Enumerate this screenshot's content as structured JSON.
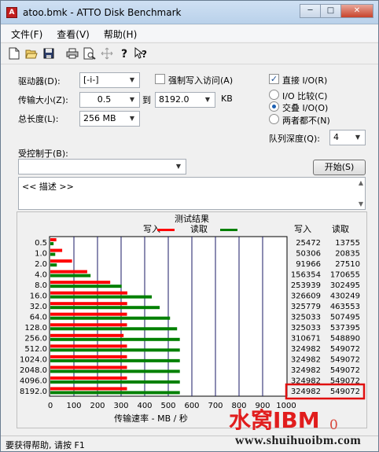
{
  "window": {
    "title": "atoo.bmk - ATTO Disk Benchmark",
    "app_icon": "A"
  },
  "title_buttons": {
    "minimize": "─",
    "maximize": "□",
    "close": "✕"
  },
  "menu": [
    "文件(F)",
    "查看(V)",
    "帮助(H)"
  ],
  "toolbar_icons": [
    "new-file-icon",
    "open-folder-icon",
    "save-icon",
    "print-icon",
    "print-preview-icon",
    "move-icon",
    "help-icon",
    "context-help-icon"
  ],
  "settings": {
    "drive_label": "驱动器(D):",
    "drive_value": "[-i-]",
    "force_write_label": "强制写入访问(A)",
    "force_write_checked": false,
    "transfer_label": "传输大小(Z):",
    "transfer_from": "0.5",
    "transfer_to_label": "到",
    "transfer_to": "8192.0",
    "transfer_unit": "KB",
    "total_label": "总长度(L):",
    "total_value": "256 MB",
    "direct_io_label": "直接 I/O(R)",
    "direct_io_checked": true,
    "io_compare_label": "I/O 比较(C)",
    "overlap_io_label": "交叠 I/O(O)",
    "neither_label": "两者都不(N)",
    "selected_io_mode": "overlap",
    "queue_label": "队列深度(Q):",
    "queue_value": "4",
    "controlled_by_label": "受控制于(B):",
    "controlled_by_value": "",
    "start_button": "开始(S)",
    "description": "<< 描述 >>"
  },
  "results": {
    "title": "测试结果",
    "legend_write": "写入",
    "legend_read": "读取",
    "col_write": "写入",
    "col_read": "读取",
    "xlabel": "传输速率 - MB / 秒"
  },
  "chart_data": {
    "type": "bar",
    "title": "测试结果",
    "xlabel": "传输速率 - MB / 秒",
    "ylabel": "",
    "categories": [
      "0.5",
      "1.0",
      "2.0",
      "4.0",
      "8.0",
      "16.0",
      "32.0",
      "64.0",
      "128.0",
      "256.0",
      "512.0",
      "1024.0",
      "2048.0",
      "4096.0",
      "8192.0"
    ],
    "series": [
      {
        "name": "写入",
        "color": "#ff0000",
        "values": [
          25472,
          50306,
          91966,
          156354,
          253939,
          326609,
          325779,
          325033,
          325033,
          310671,
          324982,
          324982,
          324982,
          324982,
          324982
        ]
      },
      {
        "name": "读取",
        "color": "#008000",
        "values": [
          13755,
          20835,
          27510,
          170655,
          302495,
          430249,
          463553,
          507495,
          537395,
          548890,
          549072,
          549072,
          549072,
          549072,
          549072
        ]
      }
    ],
    "xticks": [
      "0",
      "100",
      "200",
      "300",
      "400",
      "500",
      "600",
      "700",
      "800",
      "900",
      "1000"
    ],
    "xlim": [
      0,
      1000
    ],
    "value_unit_divisor": 1000,
    "highlighted_row": "8192.0"
  },
  "status_text": "要获得帮助, 请按 F1",
  "watermark": {
    "brand": "水窝IBM",
    "suffix": "0",
    "url": "www.shuihuoibm.com"
  }
}
